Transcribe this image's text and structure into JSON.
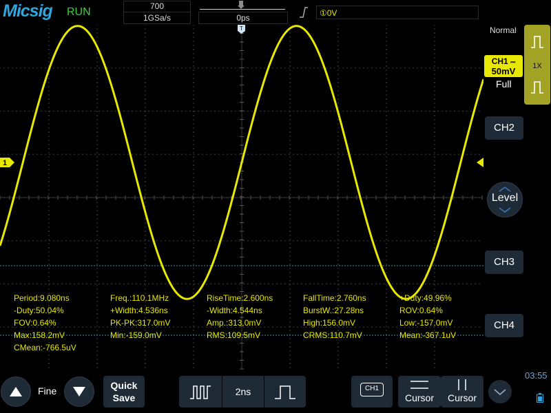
{
  "topbar": {
    "brand": "Micsig",
    "run_status": "RUN",
    "sample_count": "700",
    "sample_rate": "1GSa/s",
    "horizontal_position": "0ps",
    "trigger_level": "①0V"
  },
  "right_panel": {
    "acquisition_mode": "Normal",
    "ch1_label": "CH1",
    "ch1_coupling_symbol": "⎓",
    "ch1_scale": "50mV",
    "bandwidth": "Full",
    "probe": "1X",
    "ch2": "CH2",
    "level": "Level",
    "ch3": "CH3",
    "ch4": "CH4"
  },
  "waveform": {
    "channel_marker": "1",
    "color": "#e8e800",
    "period_ns": 9.08,
    "amplitude_mv": 158
  },
  "measurements": [
    [
      "Period:9.080ns",
      "Freq.:110.1MHz",
      "RiseTime:2.600ns",
      "FallTime:2.760ns",
      "+Duty:49.96%"
    ],
    [
      "-Duty:50.04%",
      "+Width:4.536ns",
      "-Width:4.544ns",
      "BurstW.:27.28ns",
      "ROV:0.64%"
    ],
    [
      "FOV:0.64%",
      "PK-PK:317.0mV",
      "Amp.:313.0mV",
      "High:156.0mV",
      "Low:-157.0mV"
    ],
    [
      "Max:158.2mV",
      "Min:-159.0mV",
      "RMS:109.5mV",
      "CRMS:110.7mV",
      "Mean:-367.1uV"
    ],
    [
      "CMean:-766.5uV"
    ]
  ],
  "bottombar": {
    "fine_label": "Fine",
    "quick_save_line1": "Quick",
    "quick_save_line2": "Save",
    "timebase": "2ns",
    "ch1_select": "CH1",
    "cursor1": "Cursor",
    "cursor2": "Cursor",
    "time": "03:55"
  },
  "colors": {
    "ch1": "#e8e800",
    "button_bg": "#1e2a36",
    "brand": "#2da7e0",
    "run": "#3ad23a",
    "grid": "#5a5a5a"
  }
}
